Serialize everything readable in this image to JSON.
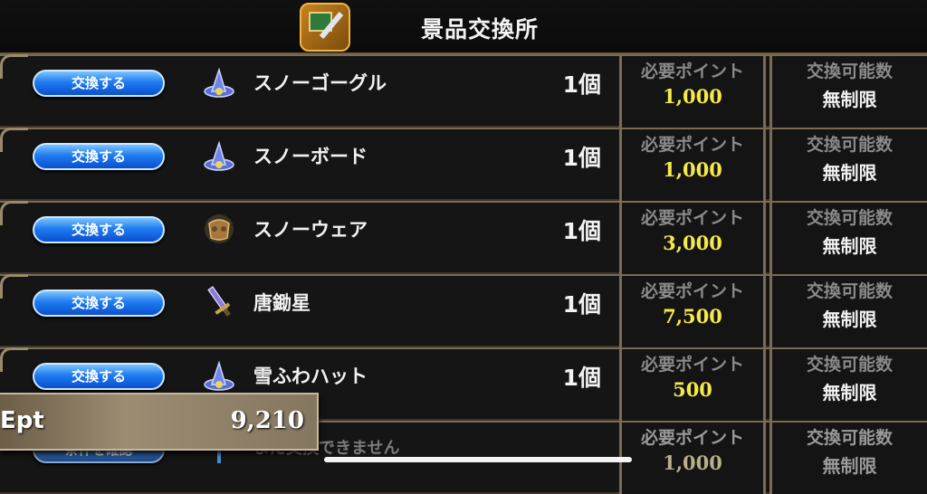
{
  "header": {
    "title": "景品交換所",
    "icon": "shop-exchange-icon"
  },
  "labels": {
    "required_points": "必要ポイント",
    "exchange_limit": "交換可能数"
  },
  "items": [
    {
      "button": "交換する",
      "icon": "hat-icon",
      "name": "スノーゴーグル",
      "qty": "1個",
      "points": "1,000",
      "limit": "無制限"
    },
    {
      "button": "交換する",
      "icon": "hat-icon",
      "name": "スノーボード",
      "qty": "1個",
      "points": "1,000",
      "limit": "無制限"
    },
    {
      "button": "交換する",
      "icon": "armor-icon",
      "name": "スノーウェア",
      "qty": "1個",
      "points": "3,000",
      "limit": "無制限"
    },
    {
      "button": "交換する",
      "icon": "sword-icon",
      "name": "唐鋤星",
      "qty": "1個",
      "points": "7,500",
      "limit": "無制限"
    },
    {
      "button": "交換する",
      "icon": "hat-icon",
      "name": "雪ふわハット",
      "qty": "1個",
      "points": "500",
      "limit": "無制限"
    },
    {
      "button": "条件を確認",
      "icon": "key-icon",
      "name": "まだ交換できません",
      "qty": "",
      "points": "1,000",
      "limit": "無制限"
    }
  ],
  "ept": {
    "label": "Ept",
    "value": "9,210"
  }
}
